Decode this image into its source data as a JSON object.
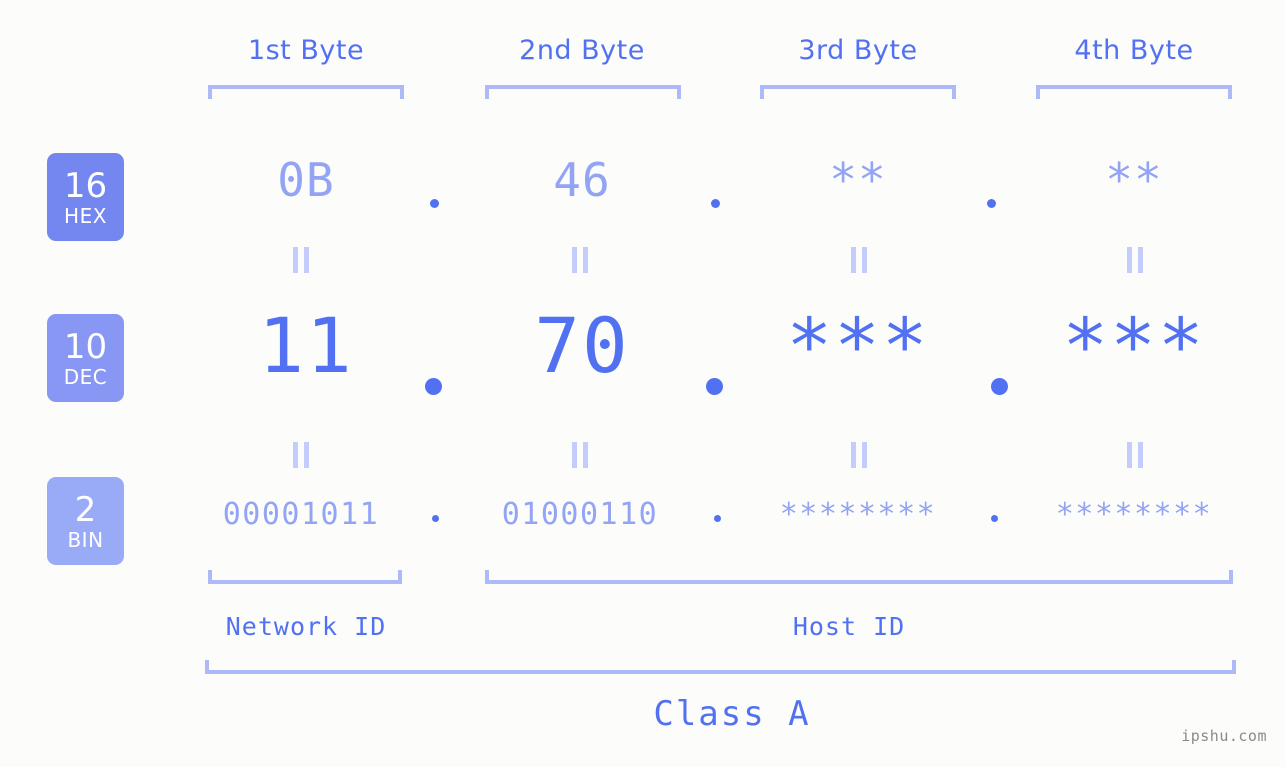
{
  "background_color": "#fcfdfa",
  "accent_color": "#5271f2",
  "accent_light_color": "#93a4f4",
  "bracket_color": "#aebaf8",
  "header": {
    "bytes": [
      {
        "label": "1st Byte"
      },
      {
        "label": "2nd Byte"
      },
      {
        "label": "3rd Byte"
      },
      {
        "label": "4th Byte"
      }
    ]
  },
  "bases": [
    {
      "number": "16",
      "name": "HEX",
      "color": "#7487f0"
    },
    {
      "number": "10",
      "name": "DEC",
      "color": "#8797f3"
    },
    {
      "number": "2",
      "name": "BIN",
      "color": "#99abf7"
    }
  ],
  "rows": {
    "hex": {
      "base_number": "16",
      "base_name": "HEX",
      "values": [
        "0B",
        "46",
        "**",
        "**"
      ],
      "separator": "."
    },
    "dec": {
      "base_number": "10",
      "base_name": "DEC",
      "values": [
        "11",
        "70",
        "***",
        "***"
      ],
      "separator": "."
    },
    "bin": {
      "base_number": "2",
      "base_name": "BIN",
      "values": [
        "00001011",
        "01000110",
        "********",
        "********"
      ],
      "separator": "."
    }
  },
  "equals_sign": "=",
  "footer": {
    "network_id_label": "Network ID",
    "host_id_label": "Host ID",
    "class_label": "Class A"
  },
  "watermark": "ipshu.com"
}
